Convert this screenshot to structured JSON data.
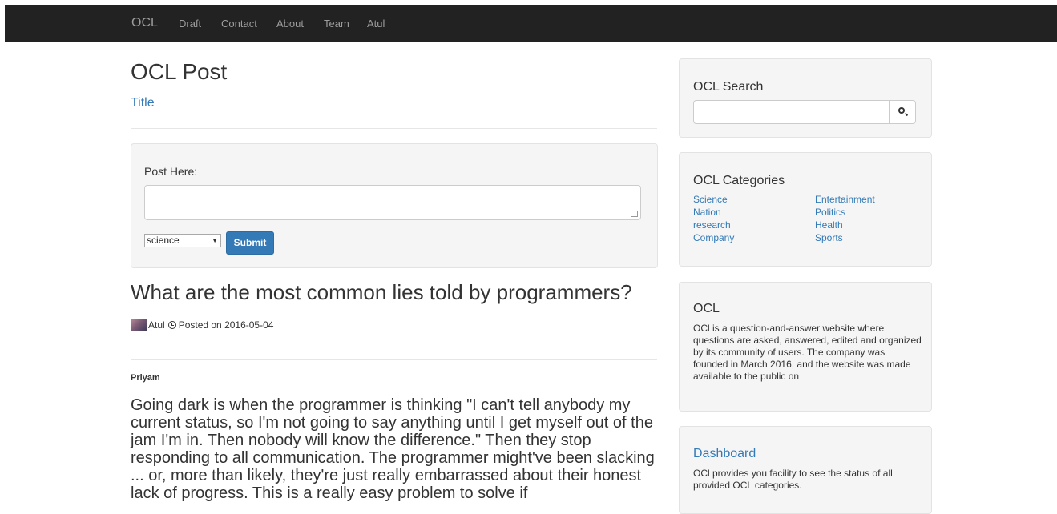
{
  "nav": {
    "brand": "OCL",
    "links": [
      "Draft",
      "Contact",
      "About",
      "Team",
      "Atul"
    ]
  },
  "header": {
    "title": "OCL Post",
    "subtitle": "Title"
  },
  "post_form": {
    "label": "Post Here:",
    "textarea_value": "",
    "category_selected": "science",
    "submit_label": "Submit"
  },
  "question": {
    "title": "What are the most common lies told by programmers?",
    "author": "Atul",
    "posted": "Posted on 2016-05-04"
  },
  "answer": {
    "author": "Priyam",
    "body": "Going dark is when the programmer is thinking \"I can't tell anybody my current status, so I'm not going to say anything until I get myself out of the jam I'm in. Then nobody will know the difference.\" Then they stop responding to all communication. The programmer might've been slacking ... or, more than likely, they're just really embarrassed about their honest lack of progress. This is a really easy problem to solve if"
  },
  "sidebar": {
    "search": {
      "title": "OCL Search",
      "value": ""
    },
    "categories": {
      "title": "OCL Categories",
      "left": [
        "Science",
        "Nation",
        "research",
        "Company"
      ],
      "right": [
        "Entertainment",
        "Politics",
        "Health",
        "Sports"
      ]
    },
    "about": {
      "title": "OCL",
      "text": "OCl is a question-and-answer website where questions are asked, answered, edited and organized by its community of users. The company was founded in March 2016, and the website was made available to the public on"
    },
    "dashboard": {
      "title": "Dashboard",
      "text": "OCl provides you facility to see the status of all provided OCL categories."
    }
  },
  "colors": {
    "navbar_bg": "#222222",
    "nav_text": "#9d9d9d",
    "link": "#337ab7",
    "button_primary": "#337ab7",
    "well_bg": "#f5f5f5"
  }
}
